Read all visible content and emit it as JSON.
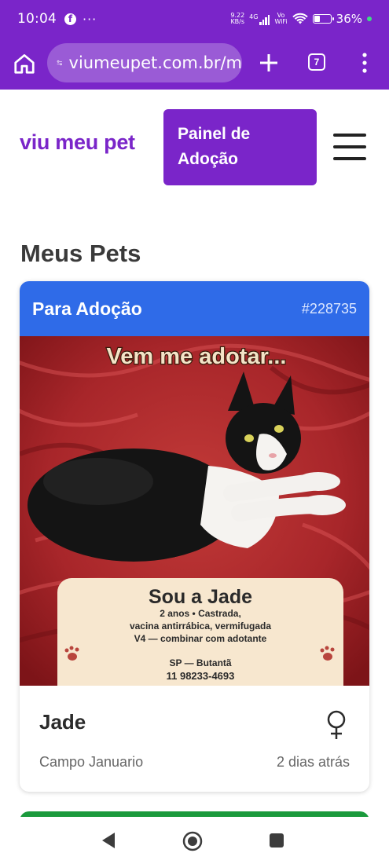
{
  "status_bar": {
    "time": "10:04",
    "notification_icon": "facebook-icon",
    "more": "···",
    "net_speed_value": "9.22",
    "net_speed_unit": "KB/s",
    "network": "4G",
    "volte_top": "Vo",
    "volte_bottom": "WiFi",
    "battery_percent": "36%",
    "battery_level": 0.36
  },
  "browser": {
    "url": "viumeupet.com.br/m",
    "tab_count": "7",
    "theme_color": "#7a25c9"
  },
  "site": {
    "logo": "viu meu pet",
    "panel_button_line1": "Painel de",
    "panel_button_line2": "Adoção",
    "menu_icon": "hamburger-icon"
  },
  "main": {
    "section_title": "Meus Pets",
    "cards": [
      {
        "status": "Para Adoção",
        "id": "#228735",
        "header_color": "#2f6be8",
        "photo": {
          "headline": "Vem me adotar...",
          "name_line": "Sou a Jade",
          "line1": "2 anos • Castrada,",
          "line2": "vacina antirrábica, vermifugada",
          "line3": "V4 — combinar com adotante",
          "location": "SP — Butantã",
          "phone": "11 98233-4693"
        },
        "name": "Jade",
        "sex_icon": "female-icon",
        "location": "Campo Januario",
        "posted": "2 dias atrás"
      }
    ],
    "next_card_color": "#1b9a3c"
  }
}
